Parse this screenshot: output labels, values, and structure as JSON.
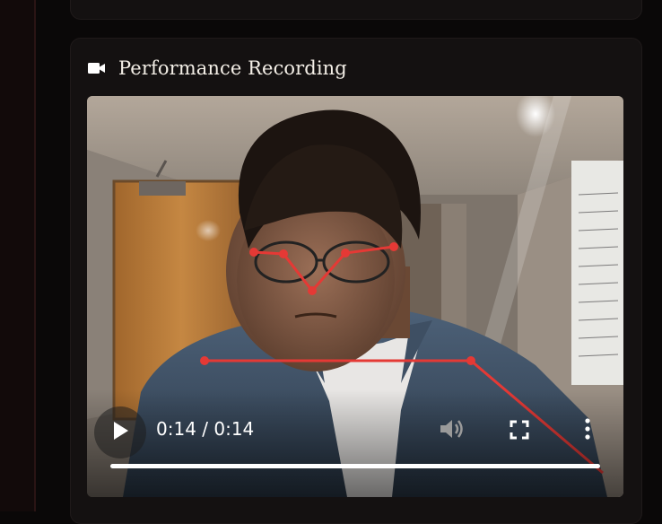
{
  "section": {
    "title": "Performance Recording",
    "icon": "video-camera-icon"
  },
  "player": {
    "time_display": "0:14 / 0:14",
    "progress": 1.0,
    "controls": [
      "play-icon",
      "volume-icon",
      "fullscreen-icon",
      "more-options-icon"
    ]
  },
  "colors": {
    "background": "#0a0808",
    "card": "#141111",
    "title_text": "#f4efe7",
    "pose_overlay": "#e53935"
  }
}
